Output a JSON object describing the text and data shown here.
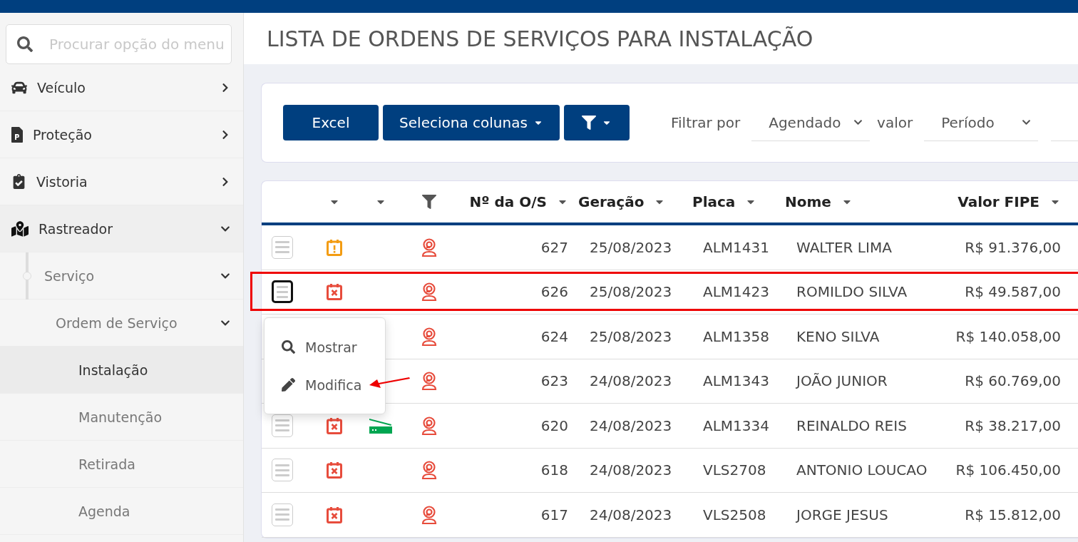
{
  "search": {
    "placeholder": "Procurar opção do menu"
  },
  "sidebar": {
    "items": [
      {
        "label": "Veículo",
        "expanded": false
      },
      {
        "label": "Proteção",
        "expanded": false
      },
      {
        "label": "Vistoria",
        "expanded": false
      },
      {
        "label": "Rastreador",
        "expanded": true,
        "children": [
          {
            "label": "Serviço",
            "expanded": true,
            "children": [
              {
                "label": "Ordem de Serviço",
                "expanded": true,
                "children": [
                  {
                    "label": "Instalação",
                    "selected": true
                  },
                  {
                    "label": "Manutenção",
                    "selected": false
                  },
                  {
                    "label": "Retirada",
                    "selected": false
                  },
                  {
                    "label": "Agenda",
                    "selected": false
                  }
                ]
              }
            ]
          }
        ]
      }
    ]
  },
  "title": "LISTA DE ORDENS DE SERVIÇOS PARA INSTALAÇÃO",
  "toolbar": {
    "buttons": [
      {
        "label": "Excel",
        "kind": "plain"
      },
      {
        "label": "Seleciona colunas",
        "kind": "dropdown"
      },
      {
        "kind": "filter"
      }
    ],
    "filter_label": "Filtrar por",
    "filter_field": "Agendado",
    "value_label": "valor",
    "value_field": "Período"
  },
  "table": {
    "columns": [
      {
        "kind": "blank"
      },
      {
        "kind": "caret"
      },
      {
        "kind": "caret"
      },
      {
        "kind": "filter"
      },
      {
        "kind": "text",
        "label": "Nº da O/S"
      },
      {
        "kind": "text",
        "label": "Geração"
      },
      {
        "kind": "text",
        "label": "Placa"
      },
      {
        "kind": "text",
        "label": "Nome"
      },
      {
        "kind": "text",
        "label": "Valor FIPE"
      }
    ],
    "rows": [
      {
        "kind": "alert",
        "scanner": false,
        "number": "627",
        "date": "25/08/2023",
        "plate": "ALM1431",
        "name": "WALTER LIMA",
        "value": "R$ 91.376,00",
        "highlighted": false,
        "menu_open": false
      },
      {
        "kind": "cancelled",
        "scanner": false,
        "number": "626",
        "date": "25/08/2023",
        "plate": "ALM1423",
        "name": "ROMILDO SILVA",
        "value": "R$ 49.587,00",
        "highlighted": true,
        "menu_open": true
      },
      {
        "scanner": false,
        "number": "624",
        "date": "25/08/2023",
        "plate": "ALM1358",
        "name": "KENO SILVA",
        "value": "R$ 140.058,00",
        "highlighted": false,
        "menu_open": false
      },
      {
        "scanner": false,
        "number": "623",
        "date": "24/08/2023",
        "plate": "ALM1343",
        "name": "JOÃO JUNIOR",
        "value": "R$ 60.769,00",
        "highlighted": false,
        "menu_open": false
      },
      {
        "kind": "cancelled",
        "scanner": true,
        "number": "620",
        "date": "24/08/2023",
        "plate": "ALM1334",
        "name": "REINALDO REIS",
        "value": "R$ 38.217,00",
        "highlighted": false,
        "menu_open": false
      },
      {
        "kind": "cancelled",
        "scanner": false,
        "number": "618",
        "date": "24/08/2023",
        "plate": "VLS2708",
        "name": "ANTONIO LOUCAO",
        "value": "R$ 106.450,00",
        "highlighted": false,
        "menu_open": false
      },
      {
        "kind": "cancelled",
        "scanner": false,
        "number": "617",
        "date": "24/08/2023",
        "plate": "VLS2508",
        "name": "JORGE JESUS",
        "value": "R$ 15.812,00",
        "highlighted": false,
        "menu_open": false
      }
    ]
  },
  "row_menu": {
    "items": [
      {
        "label": "Mostrar",
        "kind": "search",
        "pointed": false
      },
      {
        "label": "Modifica",
        "kind": "edit",
        "pointed": true
      }
    ]
  }
}
